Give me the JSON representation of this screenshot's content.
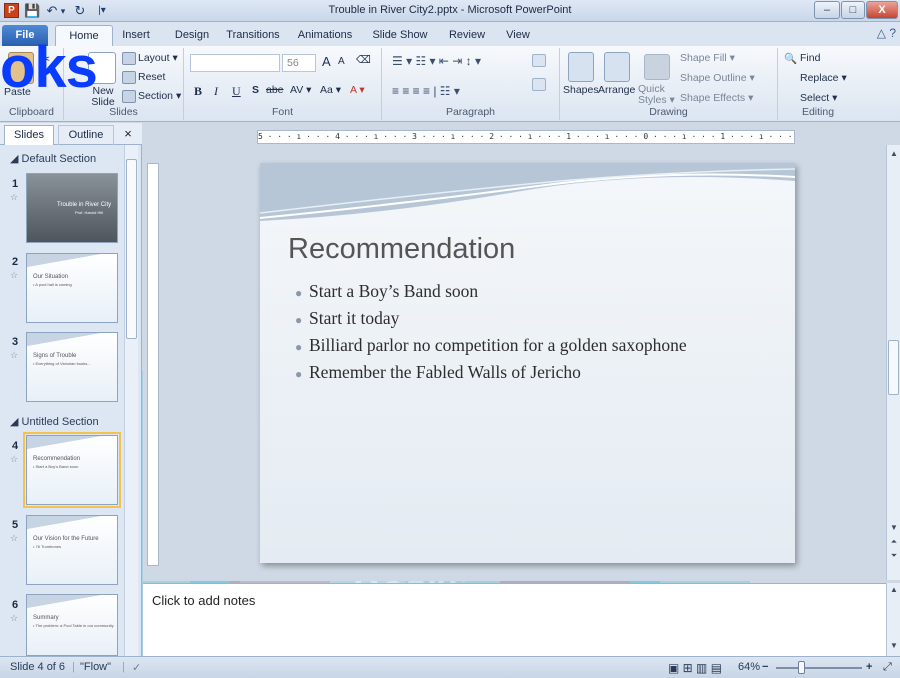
{
  "window": {
    "title": "Trouble in River City2.pptx - Microsoft PowerPoint",
    "app_icon": "P",
    "minimize": "–",
    "maximize": "□",
    "close": "X"
  },
  "qat": {
    "save": "💾",
    "undo": "↶",
    "undo_drop": "▾",
    "redo": "↻",
    "customize": "|▾"
  },
  "tabs": [
    "File",
    "Home",
    "Insert",
    "Design",
    "Transitions",
    "Animations",
    "Slide Show",
    "Review",
    "View"
  ],
  "help": "△ ?",
  "ribbon": {
    "clipboard": {
      "label": "Clipboard",
      "paste": "Paste"
    },
    "slides": {
      "label": "Slides",
      "new_slide": "New Slide",
      "layout": "Layout ▾",
      "reset": "Reset",
      "section": "Section ▾"
    },
    "font": {
      "label": "Font",
      "font_name": "",
      "font_size": "56",
      "grow": "A",
      "shrink": "A",
      "clear": "⌫",
      "bold": "B",
      "italic": "I",
      "underline": "U",
      "shadow": "S",
      "strike": "abe",
      "spacing": "AV ▾",
      "case": "Aa ▾",
      "color": "A ▾"
    },
    "paragraph": {
      "label": "Paragraph"
    },
    "drawing": {
      "label": "Drawing",
      "shapes": "Shapes",
      "arrange": "Arrange",
      "quick_styles": "Quick Styles ▾",
      "shape_fill": "Shape Fill ▾",
      "shape_outline": "Shape Outline ▾",
      "shape_effects": "Shape Effects ▾"
    },
    "editing": {
      "label": "Editing",
      "find": "Find",
      "replace": "Replace ▾",
      "select": "Select ▾"
    }
  },
  "overlay_text": "oks",
  "left_panel": {
    "tabs": [
      "Slides",
      "Outline"
    ],
    "close": "×",
    "sections": [
      "Default Section",
      "Untitled Section"
    ],
    "thumbnails": [
      {
        "num": "1",
        "star": "☆",
        "line1": "Trouble in River City",
        "line2": "Prof. Harold Hill"
      },
      {
        "num": "2",
        "star": "☆",
        "line1": "Our Situation",
        "line2": "• A pool hall is coming"
      },
      {
        "num": "3",
        "star": "☆",
        "line1": "Signs of Trouble",
        "line2": "• Everything of Victorian books..."
      },
      {
        "num": "4",
        "star": "☆",
        "line1": "Recommendation",
        "line2": "• Start a Boy's Band soon"
      },
      {
        "num": "5",
        "star": "☆",
        "line1": "Our Vision for the Future",
        "line2": "• 76 Trombones"
      },
      {
        "num": "6",
        "star": "☆",
        "line1": "Summary",
        "line2": "• The problem: a Pool Table in our community"
      }
    ]
  },
  "ruler": {
    "h": "5 · · · ı · · · 4 · · · ı · · · 3 · · · ı · · · 2 · · · ı · · · 1 · · · ı · · · 0 · · · ı · · · 1 · · · ı · · · 2 · · · ı · · · 3 · · · ı · · · 4 · · · ı · · · 5"
  },
  "slide": {
    "title": "Recommendation",
    "bullets": [
      "Start a Boy’s Band soon",
      "Start it today",
      "Billiard parlor no competition for a golden saxophone",
      "Remember the Fabled Walls of Jericho"
    ]
  },
  "notes": {
    "placeholder": "Click to add notes"
  },
  "status": {
    "slide_of": "Slide 4 of 6",
    "theme": "\"Flow\"",
    "check_icon": "✓",
    "views": "▣ ⊞ ▥ ▤",
    "zoom": "64%",
    "zoom_out": "−",
    "zoom_in": "+",
    "fit": "⤢"
  },
  "watermark_text": "DropBooks",
  "colors": {
    "accent": "#2a5fb0",
    "watermark_teal": "#2fb6d6",
    "watermark_red": "#d9485a"
  }
}
